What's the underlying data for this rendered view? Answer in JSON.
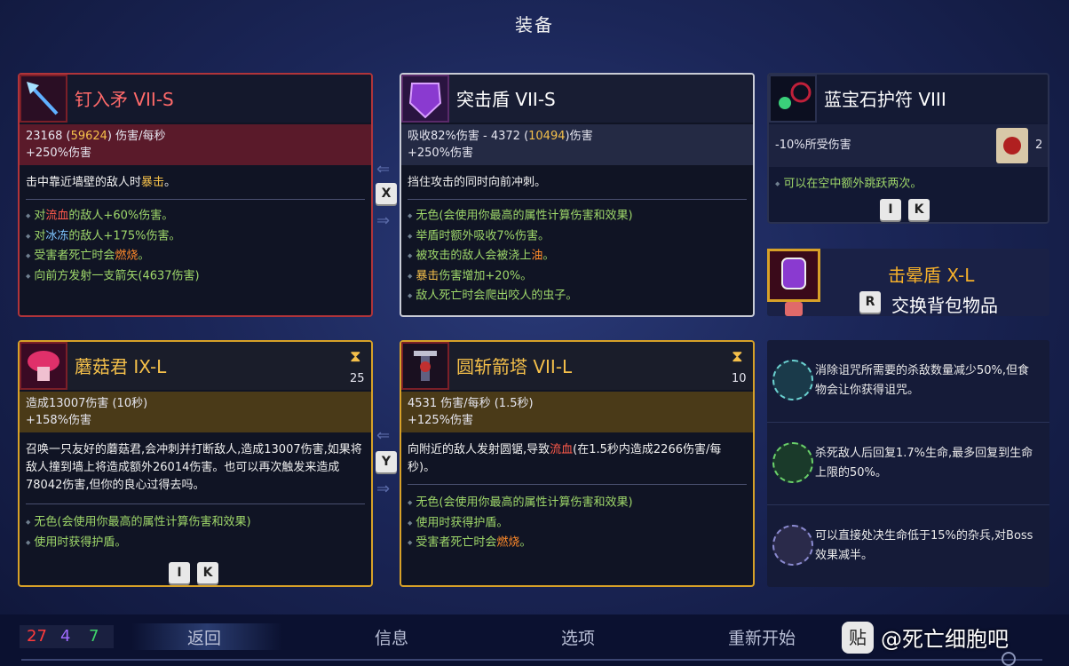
{
  "header": {
    "title": "装备"
  },
  "cards": {
    "spear": {
      "name": "钉入矛 VII-S",
      "stat_line1_a": "23168 (",
      "stat_line1_b": "59624",
      "stat_line1_c": ") 伤害/每秒",
      "stat_line2": "+250%伤害",
      "desc_a": "击中靠近墙壁的敌人时",
      "desc_b": "暴击",
      "desc_c": "。",
      "bullets": {
        "b1_a": "对",
        "b1_b": "流血",
        "b1_c": "的敌人+60%伤害。",
        "b2_a": "对",
        "b2_b": "冰冻",
        "b2_c": "的敌人+175%伤害。",
        "b3_a": "受害者死亡时会",
        "b3_b": "燃烧",
        "b3_c": "。",
        "b4": "向前方发射一支箭矢(4637伤害)"
      }
    },
    "shield": {
      "name": "突击盾 VII-S",
      "stat_line1_a": "吸收82%伤害 - 4372 (",
      "stat_line1_b": "10494",
      "stat_line1_c": ")伤害",
      "stat_line2": "+250%伤害",
      "desc": "挡住攻击的同时向前冲刺。",
      "bullets": {
        "b1": "无色(会使用你最高的属性计算伤害和效果)",
        "b2": "举盾时额外吸收7%伤害。",
        "b3_a": "被攻击的敌人会被浇上",
        "b3_b": "油",
        "b3_c": "。",
        "b4_a": "暴击",
        "b4_b": "伤害增加+20%。",
        "b5": "敌人死亡时会爬出咬人的虫子。"
      }
    },
    "amulet": {
      "name": "蓝宝石护符 VIII",
      "stat": "-10%所受伤害",
      "count": "2",
      "bullet": "可以在空中额外跳跃两次。"
    },
    "backpack": {
      "name": "击晕盾 X-L",
      "swap_label": "交换背包物品"
    },
    "mushroom": {
      "name": "蘑菇君 IX-L",
      "cooldown": "25",
      "stat_line1": "造成13007伤害 (10秒)",
      "stat_line2": "+158%伤害",
      "desc": "召唤一只友好的蘑菇君,会冲刺并打断敌人,造成13007伤害,如果将敌人撞到墙上将造成额外26014伤害。也可以再次触发来造成78042伤害,但你的良心过得去吗。",
      "bullets": {
        "b1": "无色(会使用你最高的属性计算伤害和效果)",
        "b2": "使用时获得护盾。"
      }
    },
    "turret": {
      "name": "圆斩箭塔 VII-L",
      "cooldown": "10",
      "stat_line1": "4531 伤害/每秒 (1.5秒)",
      "stat_line2": "+125%伤害",
      "desc_a": "向附近的敌人发射圆锯,导致",
      "desc_b": "流血",
      "desc_c": "(在1.5秒内造成2266伤害/每秒)。",
      "bullets": {
        "b1": "无色(会使用你最高的属性计算伤害和效果)",
        "b2": "使用时获得护盾。",
        "b3_a": "受害者死亡时会",
        "b3_b": "燃烧",
        "b3_c": "。"
      }
    }
  },
  "keys": {
    "x": "X",
    "y": "Y",
    "i": "I",
    "k": "K",
    "r": "R"
  },
  "mutations": [
    {
      "text": "消除诅咒所需要的杀敌数量减少50%,但食物会让你获得诅咒。"
    },
    {
      "text": "杀死敌人后回复1.7%生命,最多回复到生命上限的50%。"
    },
    {
      "text": "可以直接处决生命低于15%的杂兵,对Boss效果减半。"
    }
  ],
  "stats": {
    "brutality": "27",
    "tactics": "4",
    "survival": "7"
  },
  "nav": {
    "back": "返回",
    "info": "信息",
    "options": "选项",
    "restart": "重新开始"
  },
  "watermark": "@死亡细胞吧",
  "colors": {
    "red_stat": "#ff3b3b",
    "purple_stat": "#a06bff",
    "green_stat": "#3fd46a",
    "gold_border": "#d7a128"
  }
}
